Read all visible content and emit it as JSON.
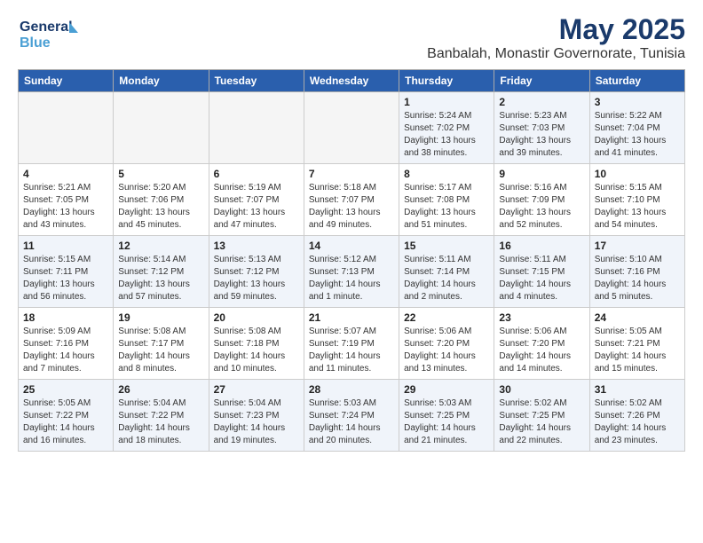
{
  "header": {
    "logo_line1": "General",
    "logo_line2": "Blue",
    "main_title": "May 2025",
    "subtitle": "Banbalah, Monastir Governorate, Tunisia"
  },
  "days_of_week": [
    "Sunday",
    "Monday",
    "Tuesday",
    "Wednesday",
    "Thursday",
    "Friday",
    "Saturday"
  ],
  "weeks": [
    [
      {
        "day": "",
        "info": ""
      },
      {
        "day": "",
        "info": ""
      },
      {
        "day": "",
        "info": ""
      },
      {
        "day": "",
        "info": ""
      },
      {
        "day": "1",
        "info": "Sunrise: 5:24 AM\nSunset: 7:02 PM\nDaylight: 13 hours\nand 38 minutes."
      },
      {
        "day": "2",
        "info": "Sunrise: 5:23 AM\nSunset: 7:03 PM\nDaylight: 13 hours\nand 39 minutes."
      },
      {
        "day": "3",
        "info": "Sunrise: 5:22 AM\nSunset: 7:04 PM\nDaylight: 13 hours\nand 41 minutes."
      }
    ],
    [
      {
        "day": "4",
        "info": "Sunrise: 5:21 AM\nSunset: 7:05 PM\nDaylight: 13 hours\nand 43 minutes."
      },
      {
        "day": "5",
        "info": "Sunrise: 5:20 AM\nSunset: 7:06 PM\nDaylight: 13 hours\nand 45 minutes."
      },
      {
        "day": "6",
        "info": "Sunrise: 5:19 AM\nSunset: 7:07 PM\nDaylight: 13 hours\nand 47 minutes."
      },
      {
        "day": "7",
        "info": "Sunrise: 5:18 AM\nSunset: 7:07 PM\nDaylight: 13 hours\nand 49 minutes."
      },
      {
        "day": "8",
        "info": "Sunrise: 5:17 AM\nSunset: 7:08 PM\nDaylight: 13 hours\nand 51 minutes."
      },
      {
        "day": "9",
        "info": "Sunrise: 5:16 AM\nSunset: 7:09 PM\nDaylight: 13 hours\nand 52 minutes."
      },
      {
        "day": "10",
        "info": "Sunrise: 5:15 AM\nSunset: 7:10 PM\nDaylight: 13 hours\nand 54 minutes."
      }
    ],
    [
      {
        "day": "11",
        "info": "Sunrise: 5:15 AM\nSunset: 7:11 PM\nDaylight: 13 hours\nand 56 minutes."
      },
      {
        "day": "12",
        "info": "Sunrise: 5:14 AM\nSunset: 7:12 PM\nDaylight: 13 hours\nand 57 minutes."
      },
      {
        "day": "13",
        "info": "Sunrise: 5:13 AM\nSunset: 7:12 PM\nDaylight: 13 hours\nand 59 minutes."
      },
      {
        "day": "14",
        "info": "Sunrise: 5:12 AM\nSunset: 7:13 PM\nDaylight: 14 hours\nand 1 minute."
      },
      {
        "day": "15",
        "info": "Sunrise: 5:11 AM\nSunset: 7:14 PM\nDaylight: 14 hours\nand 2 minutes."
      },
      {
        "day": "16",
        "info": "Sunrise: 5:11 AM\nSunset: 7:15 PM\nDaylight: 14 hours\nand 4 minutes."
      },
      {
        "day": "17",
        "info": "Sunrise: 5:10 AM\nSunset: 7:16 PM\nDaylight: 14 hours\nand 5 minutes."
      }
    ],
    [
      {
        "day": "18",
        "info": "Sunrise: 5:09 AM\nSunset: 7:16 PM\nDaylight: 14 hours\nand 7 minutes."
      },
      {
        "day": "19",
        "info": "Sunrise: 5:08 AM\nSunset: 7:17 PM\nDaylight: 14 hours\nand 8 minutes."
      },
      {
        "day": "20",
        "info": "Sunrise: 5:08 AM\nSunset: 7:18 PM\nDaylight: 14 hours\nand 10 minutes."
      },
      {
        "day": "21",
        "info": "Sunrise: 5:07 AM\nSunset: 7:19 PM\nDaylight: 14 hours\nand 11 minutes."
      },
      {
        "day": "22",
        "info": "Sunrise: 5:06 AM\nSunset: 7:20 PM\nDaylight: 14 hours\nand 13 minutes."
      },
      {
        "day": "23",
        "info": "Sunrise: 5:06 AM\nSunset: 7:20 PM\nDaylight: 14 hours\nand 14 minutes."
      },
      {
        "day": "24",
        "info": "Sunrise: 5:05 AM\nSunset: 7:21 PM\nDaylight: 14 hours\nand 15 minutes."
      }
    ],
    [
      {
        "day": "25",
        "info": "Sunrise: 5:05 AM\nSunset: 7:22 PM\nDaylight: 14 hours\nand 16 minutes."
      },
      {
        "day": "26",
        "info": "Sunrise: 5:04 AM\nSunset: 7:22 PM\nDaylight: 14 hours\nand 18 minutes."
      },
      {
        "day": "27",
        "info": "Sunrise: 5:04 AM\nSunset: 7:23 PM\nDaylight: 14 hours\nand 19 minutes."
      },
      {
        "day": "28",
        "info": "Sunrise: 5:03 AM\nSunset: 7:24 PM\nDaylight: 14 hours\nand 20 minutes."
      },
      {
        "day": "29",
        "info": "Sunrise: 5:03 AM\nSunset: 7:25 PM\nDaylight: 14 hours\nand 21 minutes."
      },
      {
        "day": "30",
        "info": "Sunrise: 5:02 AM\nSunset: 7:25 PM\nDaylight: 14 hours\nand 22 minutes."
      },
      {
        "day": "31",
        "info": "Sunrise: 5:02 AM\nSunset: 7:26 PM\nDaylight: 14 hours\nand 23 minutes."
      }
    ]
  ]
}
